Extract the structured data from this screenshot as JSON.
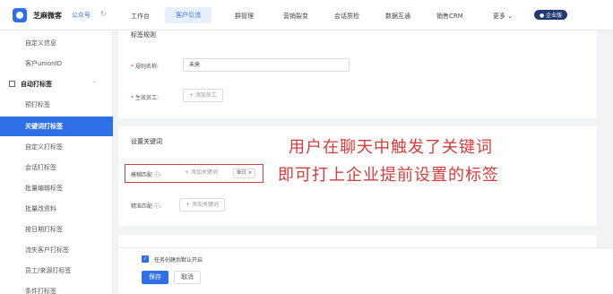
{
  "header": {
    "brand": "芝麻微客",
    "account_type": "公众号",
    "refresh_icon": "↻",
    "nav": [
      "工作台",
      "客户引流",
      "群管理",
      "营销裂变",
      "会话质检",
      "数据互通",
      "销售CRM",
      "更多 ⌄"
    ],
    "active_nav": "客户引流",
    "enterprise_badge": "● 企业版"
  },
  "sidebar": {
    "items": [
      {
        "label": "自定义信息",
        "type": "item"
      },
      {
        "label": "客户unionID",
        "type": "item"
      },
      {
        "label": "自动打标签",
        "type": "group",
        "caret": "⌃"
      },
      {
        "label": "预打标签",
        "type": "item"
      },
      {
        "label": "关键词打标签",
        "type": "item",
        "active": true
      },
      {
        "label": "自定义打标签",
        "type": "item"
      },
      {
        "label": "会话打标签",
        "type": "item"
      },
      {
        "label": "批量编辑标签",
        "type": "item"
      },
      {
        "label": "批量改资料",
        "type": "item"
      },
      {
        "label": "按日期打标签",
        "type": "item"
      },
      {
        "label": "流失客户打标签",
        "type": "item"
      },
      {
        "label": "员工/来源打标签",
        "type": "item"
      },
      {
        "label": "条件打标签",
        "type": "item"
      }
    ]
  },
  "rule_card": {
    "title": "标签规则",
    "rule_name_label": "规则名称:",
    "rule_name_value": "未来",
    "staff_label": "生效员工:",
    "staff_button": "+ 添加员工"
  },
  "keyword_card": {
    "title": "设置关键词",
    "fuzzy_label": "模糊匹配 ⓘ:",
    "fuzzy_button": "+ 添加关键词",
    "fuzzy_tag": "单日 ×",
    "exact_label": "精准匹配 ⓘ:",
    "exact_button": "+ 添加关键词"
  },
  "annotation": {
    "line1": "用户在聊天中触发了关键词",
    "line2": "即可打上企业提前设置的标签",
    "color": "#d93a3a"
  },
  "footer": {
    "checkbox_label": "任务创建后默认开启",
    "checked": true,
    "save_label": "保存",
    "cancel_label": "取消"
  },
  "colors": {
    "accent": "#2f6fe8",
    "annotation": "#d93a3a"
  }
}
